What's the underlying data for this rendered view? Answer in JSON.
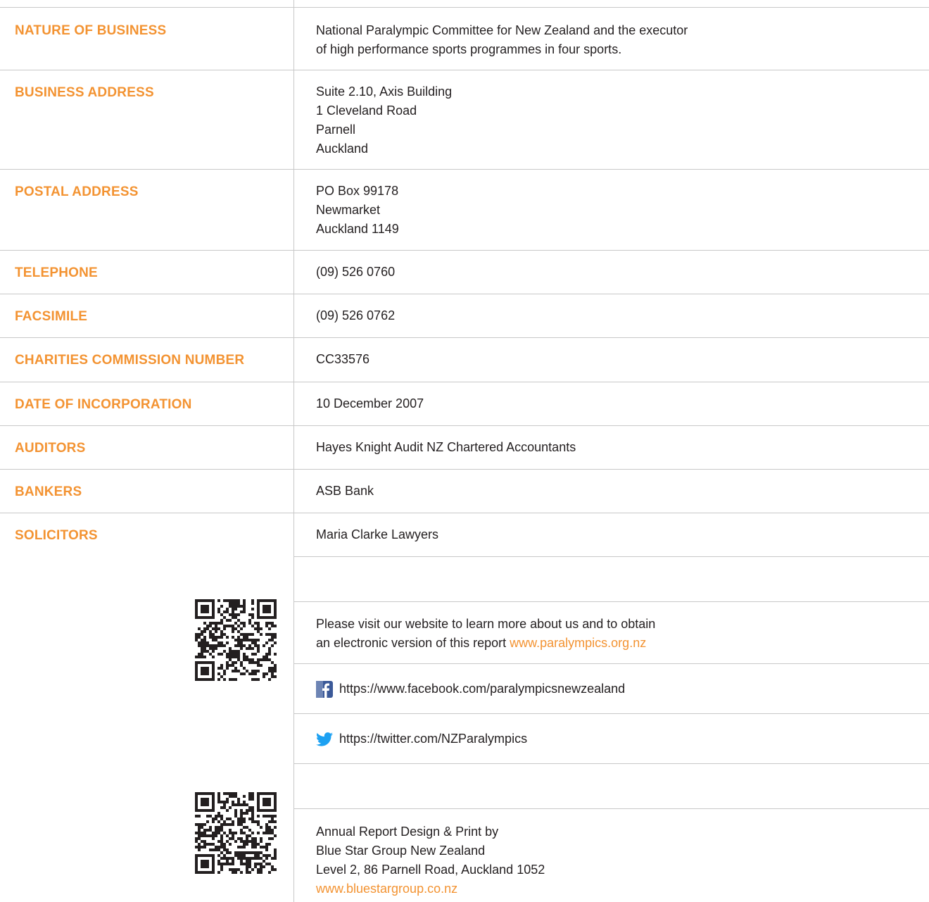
{
  "rows": [
    {
      "label": "NATURE OF BUSINESS",
      "lines": [
        "National Paralympic Committee for New Zealand and the executor",
        "of high performance sports programmes in four sports."
      ]
    },
    {
      "label": "BUSINESS ADDRESS",
      "lines": [
        "Suite 2.10, Axis Building",
        "1 Cleveland Road",
        "Parnell",
        "Auckland"
      ]
    },
    {
      "label": "POSTAL ADDRESS",
      "lines": [
        "PO Box 99178",
        "Newmarket",
        "Auckland 1149"
      ]
    },
    {
      "label": "TELEPHONE",
      "lines": [
        "(09) 526 0760"
      ]
    },
    {
      "label": "FACSIMILE",
      "lines": [
        "(09) 526 0762"
      ]
    },
    {
      "label": "CHARITIES COMMISSION NUMBER",
      "lines": [
        "CC33576"
      ]
    },
    {
      "label": "DATE OF INCORPORATION",
      "lines": [
        "10 December 2007"
      ]
    },
    {
      "label": "AUDITORS",
      "lines": [
        "Hayes Knight Audit NZ Chartered Accountants"
      ]
    },
    {
      "label": "BANKERS",
      "lines": [
        "ASB Bank"
      ]
    },
    {
      "label": "SOLICITORS",
      "lines": [
        "Maria Clarke Lawyers"
      ]
    }
  ],
  "website": {
    "line1": "Please visit our website to learn more about us and to obtain",
    "line2_prefix": "an electronic version of this report ",
    "url": "www.paralympics.org.nz"
  },
  "social": {
    "facebook": {
      "icon": "facebook-icon",
      "url": "https://www.facebook.com/paralympicsnewzealand"
    },
    "twitter": {
      "icon": "twitter-icon",
      "url": "https://twitter.com/NZParalympics"
    }
  },
  "credits": {
    "lines": [
      "Annual Report Design & Print by",
      "Blue Star Group New Zealand",
      "Level 2, 86 Parnell Road, Auckland 1052"
    ],
    "url": "www.bluestargroup.co.nz"
  },
  "colors": {
    "accent": "#f39332",
    "text": "#231f20",
    "rule": "#c8c8c8",
    "facebook": "#3b5998",
    "twitter": "#1da1f2"
  },
  "qr_codes": [
    {
      "icon": "qr-code-icon",
      "target": "website"
    },
    {
      "icon": "qr-code-icon",
      "target": "blue-star-group"
    }
  ]
}
